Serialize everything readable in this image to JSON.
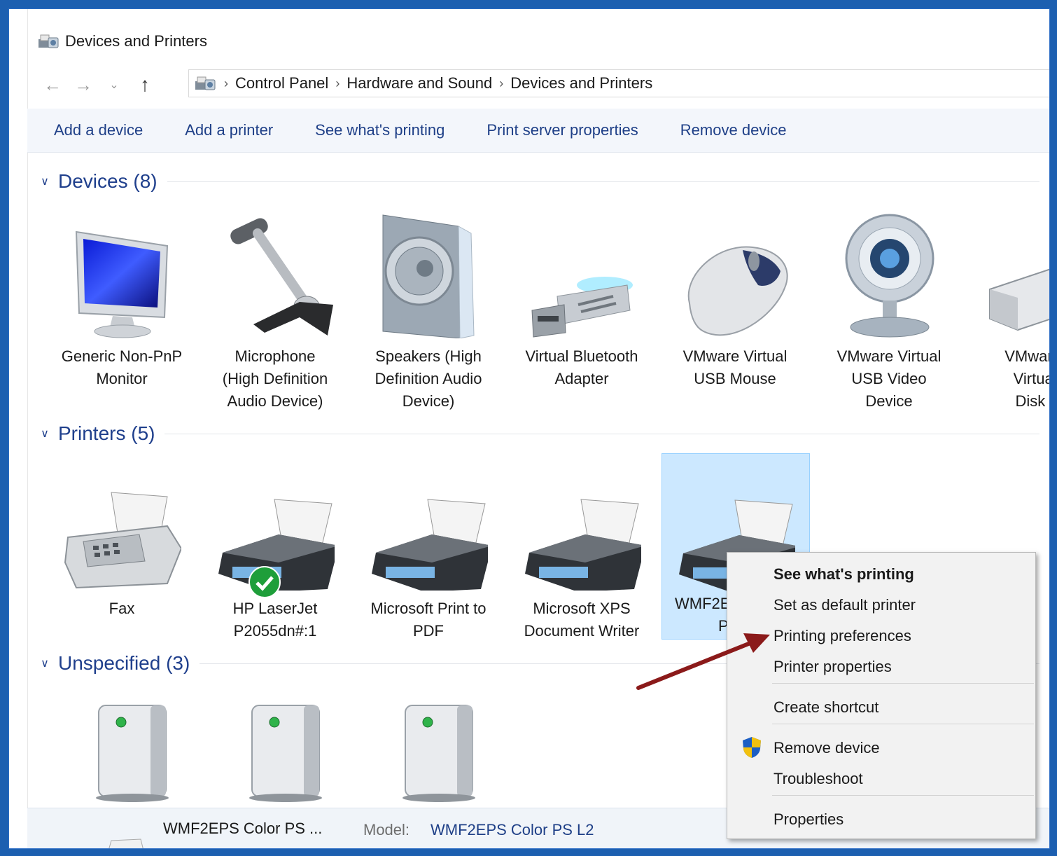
{
  "window": {
    "title": "Devices and Printers"
  },
  "breadcrumb": [
    "Control Panel",
    "Hardware and Sound",
    "Devices and Printers"
  ],
  "commands": [
    "Add a device",
    "Add a printer",
    "See what's printing",
    "Print server properties",
    "Remove device"
  ],
  "groups": {
    "devices": {
      "title": "Devices (8)",
      "items": [
        {
          "line1": "Generic Non-PnP",
          "line2": "Monitor",
          "line3": "",
          "icon": "monitor-icon"
        },
        {
          "line1": "Microphone",
          "line2": "(High Definition",
          "line3": "Audio Device)",
          "icon": "microphone-icon"
        },
        {
          "line1": "Speakers (High",
          "line2": "Definition Audio",
          "line3": "Device)",
          "icon": "speaker-icon"
        },
        {
          "line1": "Virtual Bluetooth",
          "line2": "Adapter",
          "line3": "",
          "icon": "usb-adapter-icon"
        },
        {
          "line1": "VMware Virtual",
          "line2": "USB Mouse",
          "line3": "",
          "icon": "mouse-icon"
        },
        {
          "line1": "VMware Virtual",
          "line2": "USB Video",
          "line3": "Device",
          "icon": "webcam-icon"
        },
        {
          "line1": "VMware, V",
          "line2": "Virtual S",
          "line3": "Disk De",
          "icon": "disk-drive-icon"
        }
      ]
    },
    "printers": {
      "title": "Printers (5)",
      "items": [
        {
          "line1": "Fax",
          "line2": "",
          "icon": "fax-icon"
        },
        {
          "line1": "HP LaserJet",
          "line2": "P2055dn#:1",
          "icon": "printer-icon",
          "default": true
        },
        {
          "line1": "Microsoft Print to",
          "line2": "PDF",
          "icon": "printer-icon"
        },
        {
          "line1": "Microsoft XPS",
          "line2": "Document Writer",
          "icon": "printer-icon"
        },
        {
          "line1": "WMF2E",
          "line2": "PS",
          "icon": "printer-icon",
          "selected": true
        }
      ]
    },
    "unspecified": {
      "title": "Unspecified (3)"
    }
  },
  "status": {
    "name": "WMF2EPS Color PS ...",
    "model_label": "Model:",
    "model_value": "WMF2EPS Color PS L2"
  },
  "context_menu": {
    "items": [
      "See what's printing",
      "Set as default printer",
      "Printing preferences",
      "Printer properties",
      "Create shortcut",
      "Remove device",
      "Troubleshoot",
      "Properties"
    ]
  },
  "colors": {
    "accent": "#1f3f8c",
    "selection": "#cce8ff",
    "annotation_arrow": "#8b1a1a",
    "default_check": "#1e9e3a"
  }
}
